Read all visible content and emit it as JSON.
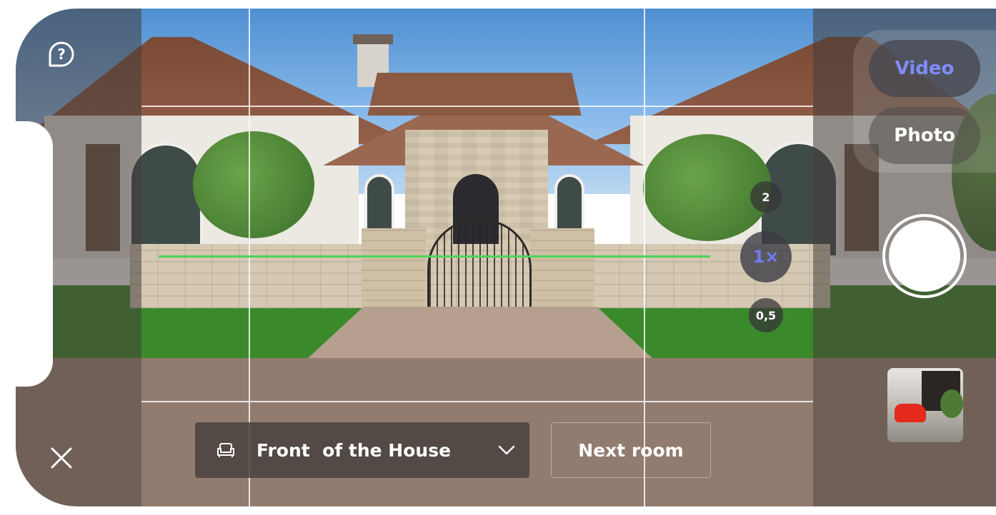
{
  "camera": {
    "modes": {
      "video": "Video",
      "photo": "Photo"
    },
    "zoom_levels": {
      "high": "2",
      "current": "1×",
      "low": "0,5"
    }
  },
  "room_selector": {
    "label": "Front  of the House"
  },
  "next_room_label": "Next room",
  "icons": {
    "help": "help-bubble-icon",
    "close": "close-icon",
    "room": "sofa-icon",
    "dropdown": "chevron-down-icon"
  },
  "colors": {
    "accent": "#6f7cff",
    "level_line": "#4ad45b"
  }
}
